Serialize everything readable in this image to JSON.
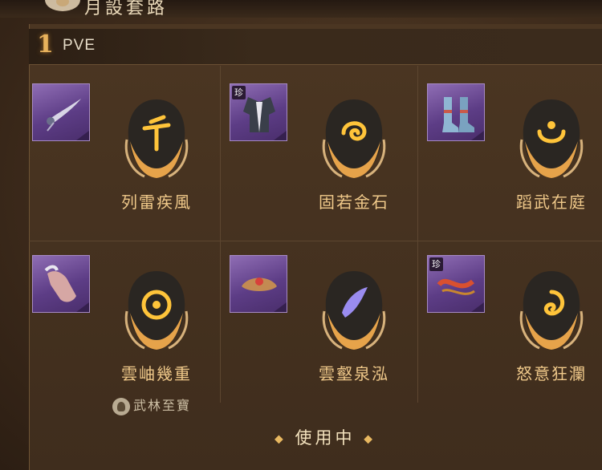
{
  "header": {
    "number": "1",
    "label": "PVE"
  },
  "top_title": "月設套路",
  "colors": {
    "accent": "#f0c98a",
    "gold": "#e8b25c",
    "purple": "#6a4797"
  },
  "cells": [
    {
      "name": "列雷疾風",
      "rare": "",
      "item_icon": "fan-hairpin-icon",
      "emblem_icon": "sword-icon"
    },
    {
      "name": "固若金石",
      "rare": "珍",
      "item_icon": "armor-robe-icon",
      "emblem_icon": "cloud-swirl-icon"
    },
    {
      "name": "蹈武在庭",
      "rare": "",
      "item_icon": "boots-icon",
      "emblem_icon": "crescent-icon"
    },
    {
      "name": "雲岫幾重",
      "rare": "",
      "item_icon": "bracer-icon",
      "emblem_icon": "mask-icon",
      "sub_tag": "武林至寶"
    },
    {
      "name": "雲壑泉泓",
      "rare": "",
      "item_icon": "crown-icon",
      "emblem_icon": "flame-eye-icon"
    },
    {
      "name": "怒意狂瀾",
      "rare": "珍",
      "item_icon": "red-sash-icon",
      "emblem_icon": "vortex-icon"
    }
  ],
  "status": {
    "label": "使用中"
  }
}
